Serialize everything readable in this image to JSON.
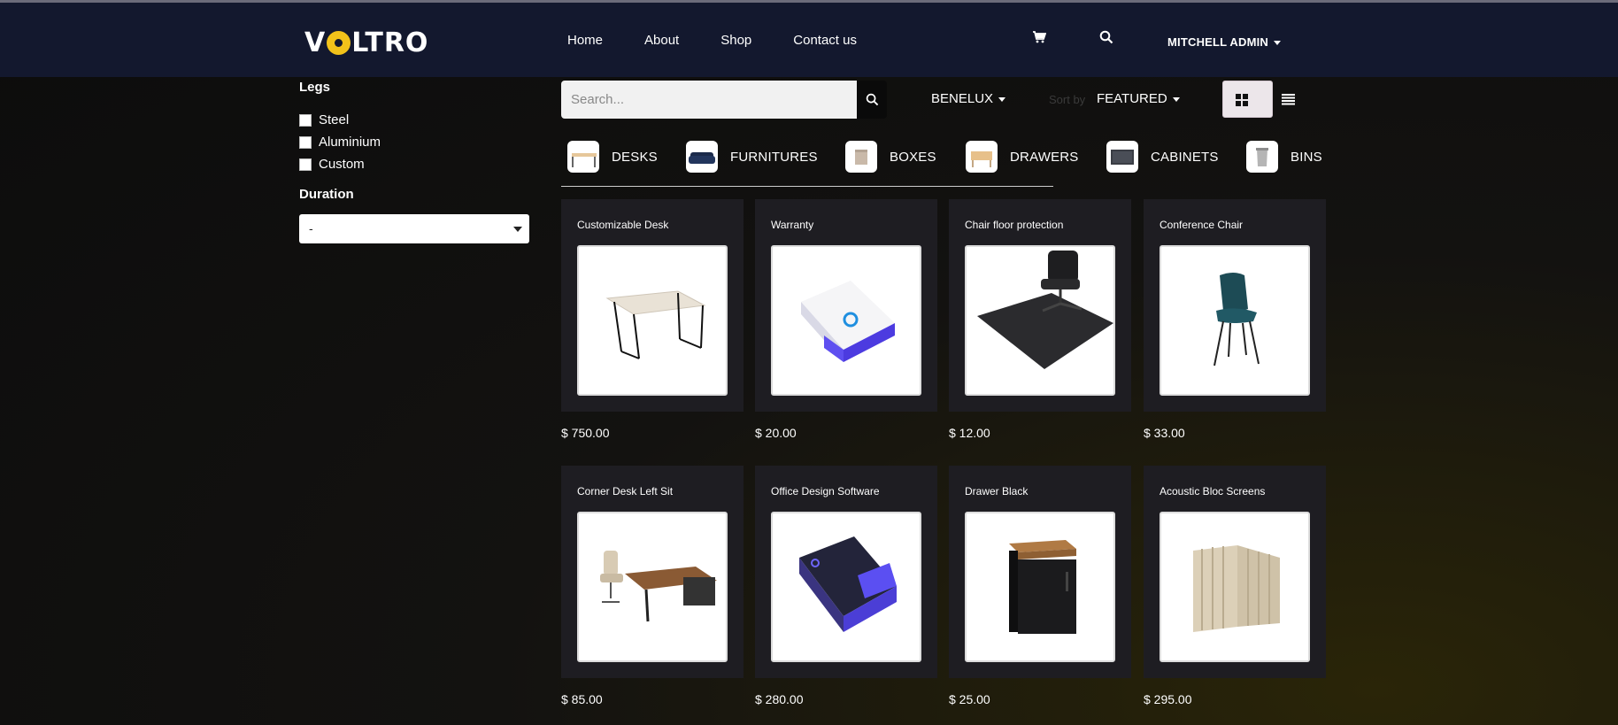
{
  "header": {
    "logo_text": "VOLTRO",
    "nav": [
      "Home",
      "About",
      "Shop",
      "Contact us"
    ],
    "user": "MITCHELL ADMIN"
  },
  "sidebar": {
    "legs_title": "Legs",
    "legs_options": [
      "Steel",
      "Aluminium",
      "Custom"
    ],
    "duration_title": "Duration",
    "duration_value": "-"
  },
  "toolbar": {
    "search_placeholder": "Search...",
    "pricelist": "BENELUX",
    "sortby_label": "Sort by",
    "sortby_value": "FEATURED"
  },
  "categories": [
    "DESKS",
    "FURNITURES",
    "BOXES",
    "DRAWERS",
    "CABINETS",
    "BINS"
  ],
  "products": [
    {
      "name": "Customizable Desk",
      "price": "$ 750.00"
    },
    {
      "name": "Warranty",
      "price": "$ 20.00"
    },
    {
      "name": "Chair floor protection",
      "price": "$ 12.00"
    },
    {
      "name": "Conference Chair",
      "price": "$ 33.00"
    },
    {
      "name": "Corner Desk Left Sit",
      "price": "$ 85.00"
    },
    {
      "name": "Office Design Software",
      "price": "$ 280.00"
    },
    {
      "name": "Drawer Black",
      "price": "$ 25.00"
    },
    {
      "name": "Acoustic Bloc Screens",
      "price": "$ 295.00"
    }
  ],
  "colors": {
    "header_bg": "#13182e",
    "accent": "#8a4d7a",
    "logo_yellow": "#f2c21a"
  }
}
